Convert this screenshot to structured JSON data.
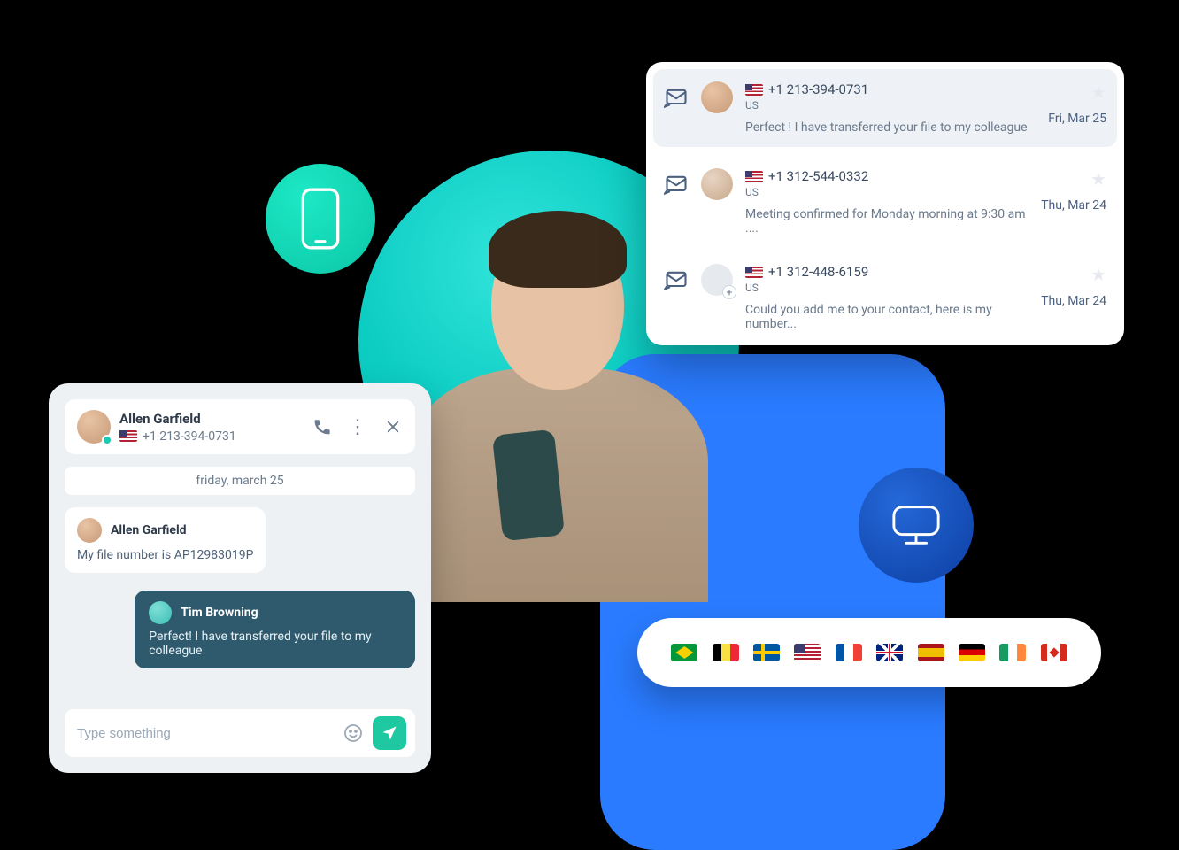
{
  "chat": {
    "contact": {
      "name": "Allen Garfield",
      "phone": "+1 213-394-0731",
      "country_code": "US"
    },
    "date_divider": "friday, march 25",
    "messages": [
      {
        "direction": "in",
        "sender": "Allen Garfield",
        "body": "My file number is AP12983019P"
      },
      {
        "direction": "out",
        "sender": "Tim Browning",
        "body": "Perfect! I have transferred your file to my colleague"
      }
    ],
    "composer": {
      "placeholder": "Type something"
    }
  },
  "inbox": [
    {
      "phone": "+1 213-394-0731",
      "country_code": "US",
      "preview": "Perfect ! I have transferred your file to my colleague",
      "date": "Fri, Mar 25",
      "selected": true,
      "avatar": "photo"
    },
    {
      "phone": "+1 312-544-0332",
      "country_code": "US",
      "preview": "Meeting confirmed for Monday morning at 9:30 am ....",
      "date": "Thu, Mar 24",
      "selected": false,
      "avatar": "photo"
    },
    {
      "phone": "+1 312-448-6159",
      "country_code": "US",
      "preview": "Could you add me to your contact, here is my number...",
      "date": "Thu, Mar 24",
      "selected": false,
      "avatar": "placeholder"
    }
  ],
  "decor": {
    "teal_icon": "phone-icon",
    "blue_icon": "monitor-icon"
  },
  "flags": [
    "br",
    "be",
    "se",
    "us",
    "fr",
    "gb",
    "es",
    "de",
    "ie",
    "ca"
  ]
}
